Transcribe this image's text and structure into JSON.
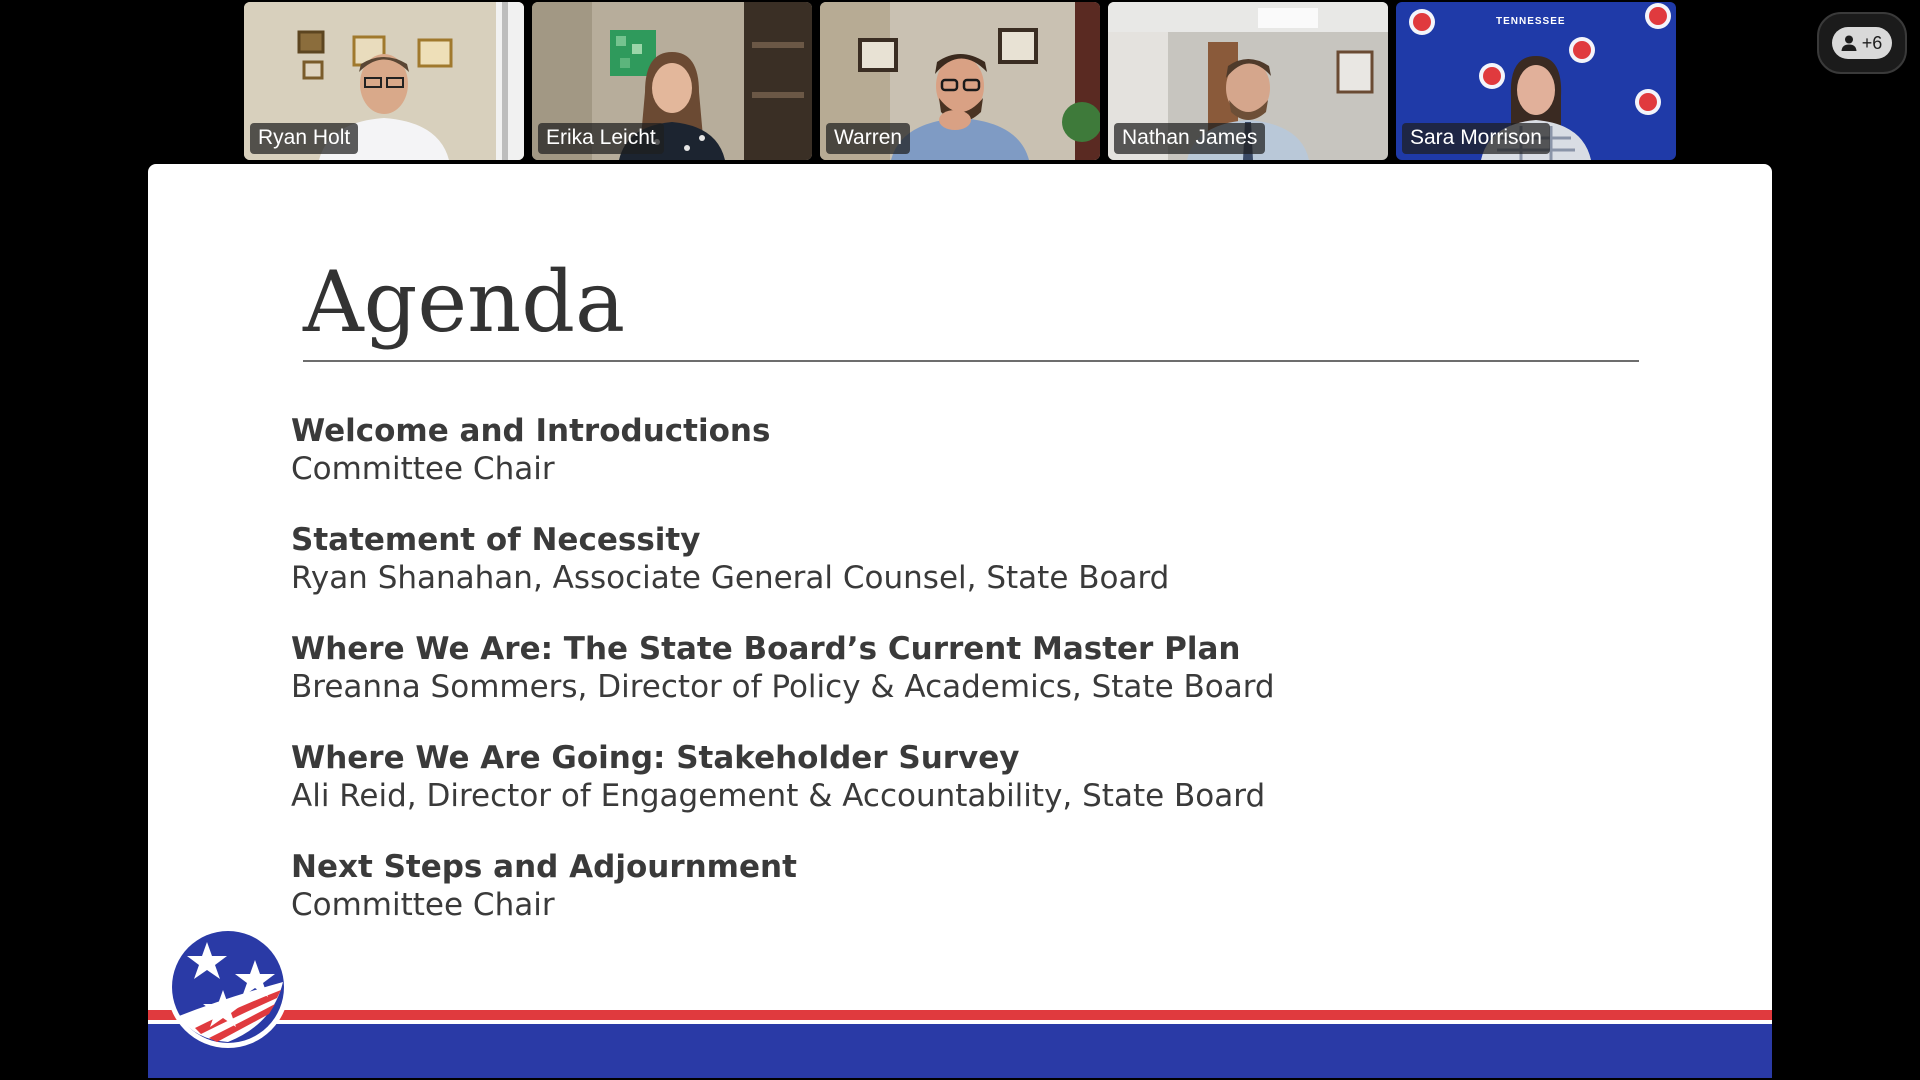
{
  "participants": [
    {
      "name": "Ryan Holt"
    },
    {
      "name": "Erika Leicht"
    },
    {
      "name": "Warren"
    },
    {
      "name": "Nathan James"
    },
    {
      "name": "Sara Morrison"
    }
  ],
  "overflow_button": {
    "label": "+6",
    "icon": "person-icon"
  },
  "slide": {
    "title": "Agenda",
    "items": [
      {
        "heading": "Welcome and Introductions",
        "sub": "Committee Chair"
      },
      {
        "heading": "Statement of Necessity",
        "sub": "Ryan Shanahan, Associate General Counsel, State Board"
      },
      {
        "heading": "Where We Are: The State Board’s Current Master Plan",
        "sub": "Breanna Sommers, Director of Policy & Academics, State Board"
      },
      {
        "heading": "Where We Are Going: Stakeholder Survey",
        "sub": "Ali Reid, Director of Engagement & Accountability, State Board"
      },
      {
        "heading": "Next Steps and Adjournment",
        "sub": "Committee Chair"
      }
    ],
    "logo_icon": "tennessee-tristar-icon"
  },
  "backdrop_text": "TENNESSEE",
  "colors": {
    "background": "#000000",
    "slide_bg": "#ffffff",
    "footer_red": "#e03a3e",
    "footer_blue": "#2a3aa6",
    "text": "#3a3a3a"
  }
}
